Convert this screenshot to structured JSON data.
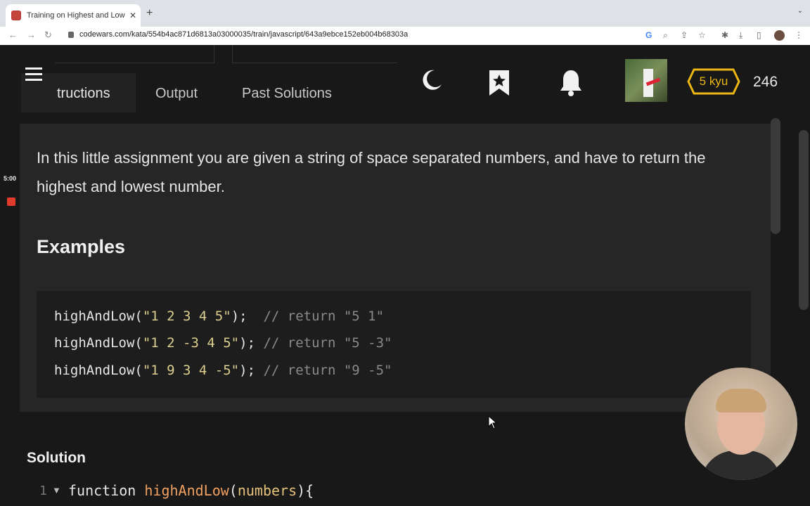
{
  "browser": {
    "tab_title": "Training on Highest and Lowest",
    "url": "codewars.com/kata/554b4ac871d6813a03000035/train/javascript/643a9ebce152eb004b68303a"
  },
  "header": {
    "tabs": [
      {
        "label": "tructions"
      },
      {
        "label": "Output"
      },
      {
        "label": "Past Solutions"
      }
    ],
    "rank": "5 kyu",
    "honor": "246",
    "rank_color": "#ecb613"
  },
  "sidebar": {
    "timer": "5:00"
  },
  "main": {
    "description": "In this little assignment you are given a string of space separated numbers, and have to return the highest and lowest number.",
    "examples_heading": "Examples",
    "examples": [
      {
        "call": "highAndLow(",
        "arg": "\"1 2 3 4 5\"",
        "close": ");",
        "gap": "  ",
        "comment": "// return \"5 1\""
      },
      {
        "call": "highAndLow(",
        "arg": "\"1 2 -3 4 5\"",
        "close": ");",
        "gap": " ",
        "comment": "// return \"5 -3\""
      },
      {
        "call": "highAndLow(",
        "arg": "\"1 9 3 4 -5\"",
        "close": ");",
        "gap": " ",
        "comment": "// return \"9 -5\""
      }
    ]
  },
  "solution": {
    "heading": "Solution",
    "line_number": "1",
    "keyword": "function",
    "fn_name": "highAndLow",
    "param": "numbers",
    "open": "(",
    "close": "){"
  }
}
